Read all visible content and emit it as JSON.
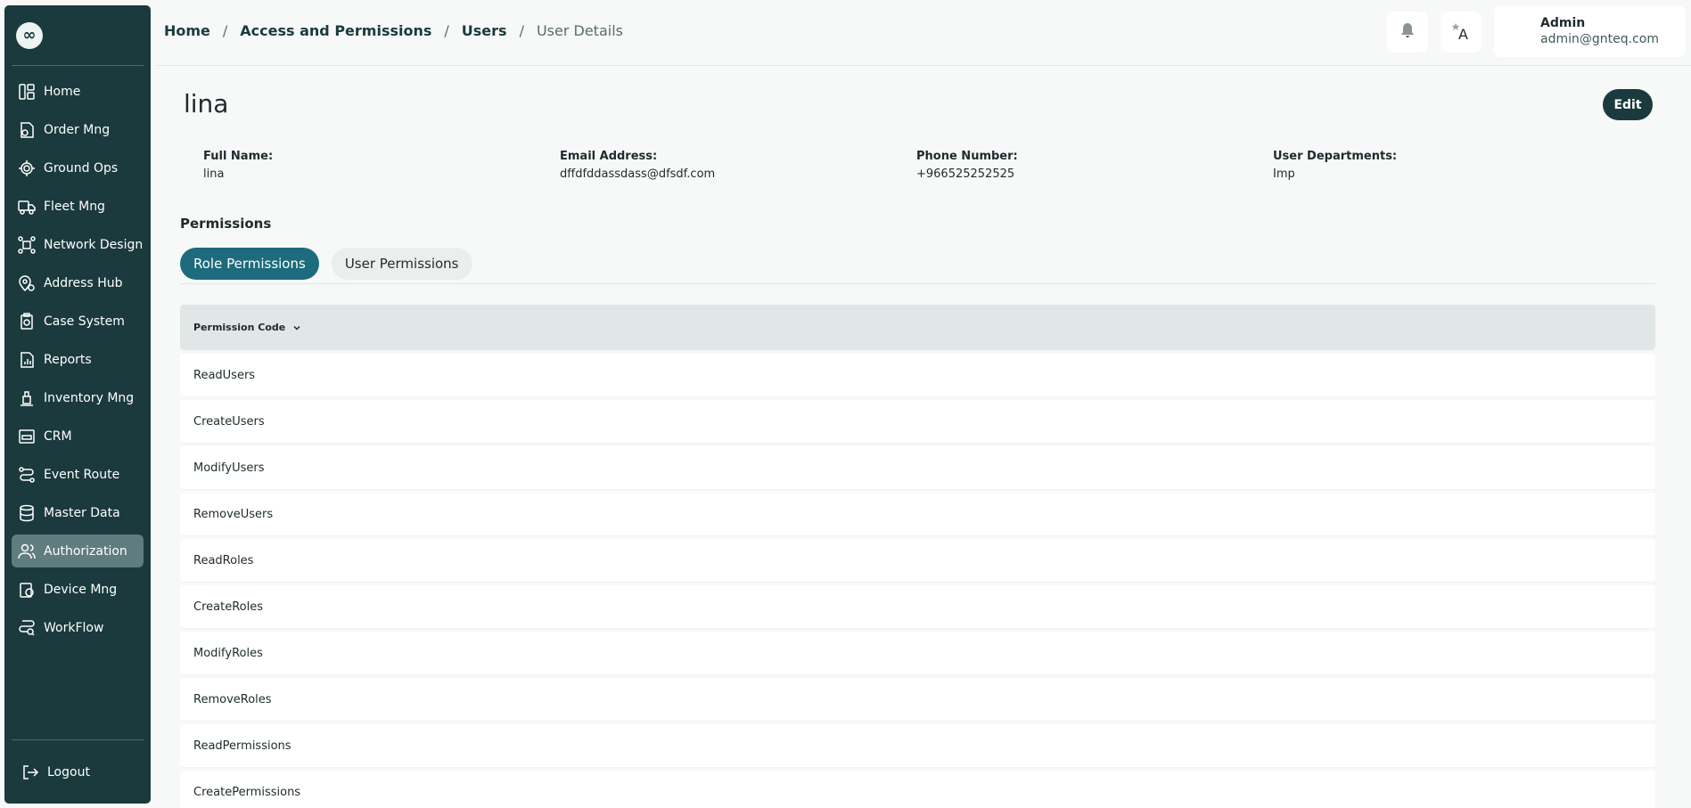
{
  "sidebar": {
    "logo": "∞",
    "items": [
      {
        "label": "Home",
        "icon": "home-icon"
      },
      {
        "label": "Order Mng",
        "icon": "order-icon"
      },
      {
        "label": "Ground Ops",
        "icon": "ground-ops-icon"
      },
      {
        "label": "Fleet Mng",
        "icon": "truck-icon"
      },
      {
        "label": "Network Design",
        "icon": "network-icon"
      },
      {
        "label": "Address Hub",
        "icon": "location-icon"
      },
      {
        "label": "Case System",
        "icon": "case-icon"
      },
      {
        "label": "Reports",
        "icon": "report-icon"
      },
      {
        "label": "Inventory Mng",
        "icon": "inventory-icon"
      },
      {
        "label": "CRM",
        "icon": "crm-icon"
      },
      {
        "label": "Event Route",
        "icon": "route-icon"
      },
      {
        "label": "Master Data",
        "icon": "database-icon"
      },
      {
        "label": "Authorization",
        "icon": "users-icon"
      },
      {
        "label": "Device Mng",
        "icon": "device-icon"
      },
      {
        "label": "WorkFlow",
        "icon": "workflow-icon"
      }
    ],
    "active_item": "Authorization",
    "logout_label": "Logout"
  },
  "breadcrumb": {
    "home": "Home",
    "sep": "/",
    "access": "Access and Permissions",
    "users": "Users",
    "current": "User Details"
  },
  "header": {
    "user_name": "Admin",
    "user_email": "admin@gnteq.com",
    "lang_label": "A"
  },
  "page": {
    "title": "lina",
    "edit_label": "Edit"
  },
  "details": {
    "full_name_label": "Full Name:",
    "full_name": "lina",
    "email_label": "Email Address:",
    "email": "dffdfddassdass@dfsdf.com",
    "phone_label": "Phone Number:",
    "phone": "+966525252525",
    "departments_label": "User Departments:",
    "departments": "Imp"
  },
  "permissions": {
    "title": "Permissions",
    "tabs": [
      "Role Permissions",
      "User Permissions"
    ],
    "active_tab": "Role Permissions",
    "column_header": "Permission Code",
    "rows": [
      "ReadUsers",
      "CreateUsers",
      "ModifyUsers",
      "RemoveUsers",
      "ReadRoles",
      "CreateRoles",
      "ModifyRoles",
      "RemoveRoles",
      "ReadPermissions",
      "CreatePermissions"
    ]
  },
  "colors": {
    "sidebar_bg": "#1b3a3d",
    "active_tab": "#1d6b7c",
    "edit_button": "#1b3a3d",
    "active_nav": "#5f7c7e"
  }
}
